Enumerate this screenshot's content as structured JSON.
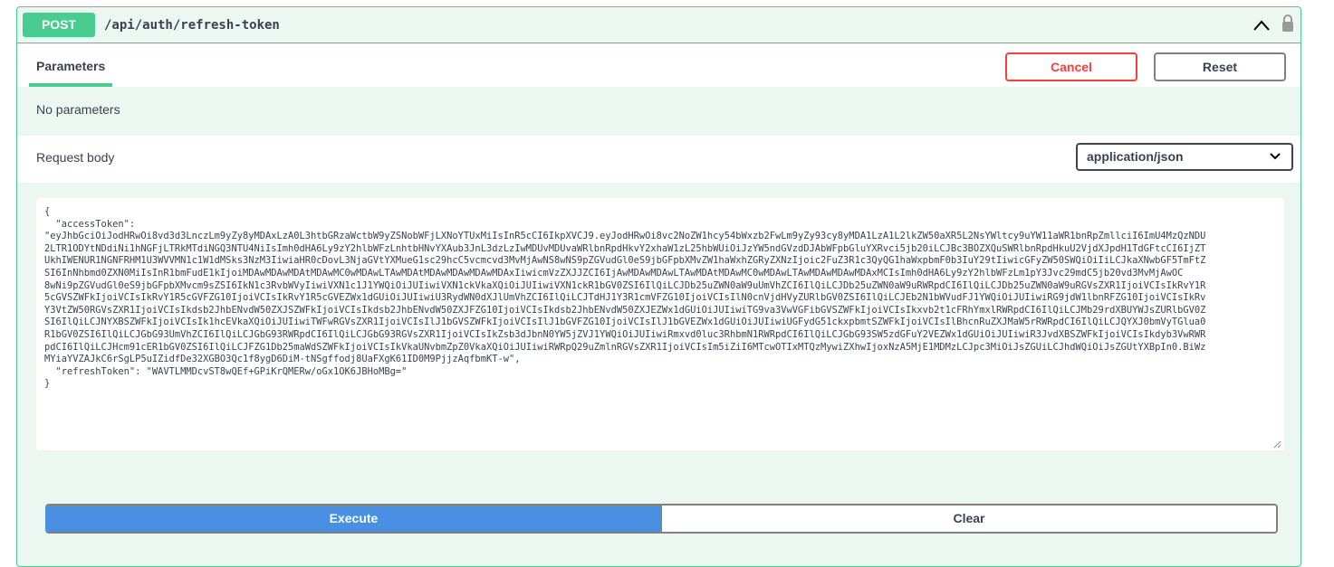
{
  "operation": {
    "method": "POST",
    "path": "/api/auth/refresh-token"
  },
  "parameters": {
    "tab_label": "Parameters",
    "cancel_label": "Cancel",
    "reset_label": "Reset",
    "empty_text": "No parameters"
  },
  "request_body": {
    "label": "Request body",
    "content_type": "application/json",
    "body_lines": [
      "{",
      "  \"accessToken\":",
      "\"eyJhbGciOiJodHRwOi8vd3d3LnczLm9yZy8yMDAxLzA0L3htbGRzaWctbW9yZSNobWFjLXNoYTUxMiIsInR5cCI6IkpXVCJ9.eyJodHRwOi8vc2NoZW1hcy54bWxzb2FwLm9yZy93cy8yMDA1LzA1L2lkZW50aXR5L2NsYWltcy9uYW11aWR1bnRpZmllciI6ImU4MzQzNDU",
      "2LTR1ODYtNDdiNi1hNGFjLTRkMTdiNGQ3NTU4NiIsImh0dHA6Ly9zY2hlbWFzLnhtbHNvYXAub3JnL3dzLzIwMDUvMDUvaWRlbnRpdHkvY2xhaW1zL25hbWUiOiJzYW5ndGVzdDJAbWFpbGluYXRvci5jb20iLCJBc3BOZXQuSWRlbnRpdHkuU2VjdXJpdH1TdGFtcCI6IjZT",
      "UkhIWENUR1NGNFRHM1U3WVVMN1c1W1dMSks3NzM3IiwiaHR0cDovL3NjaGVtYXMueG1sc29hcC5vcmcvd3MvMjAwNS8wNS9pZGVudGl0eS9jbGFpbXMvZW1haWxhZGRyZXNzIjoic2FuZ3R1c3QyQG1haWxpbmF0b3IuY29tIiwicGFyZW50SWQiOiIiLCJkaXNwbGF5TmFtZ",
      "SI6InNhbmd0ZXN0MiIsInR1bmFudE1kIjoiMDAwMDAwMDAtMDAwMC0wMDAwLTAwMDAtMDAwMDAwMDAwMDAxIiwicmVzZXJJZCI6IjAwMDAwMDAwLTAwMDAtMDAwMC0wMDAwLTAwMDAwMDAwMDAxMCIsImh0dHA6Ly9zY2hlbWFzLm1pY3Jvc29mdC5jb20vd3MvMjAwOC",
      "8wNi9pZGVudGl0eS9jbGFpbXMvcm9sZSI6IkN1c3RvbWVyIiwiVXN1c1J1YWQiOiJUIiwiVXN1ckVkaXQiOiJUIiwiVXN1ckR1bGV0ZSI6IlQiLCJDb25uZWN0aW9uUmVhZCI6IlQiLCJDb25uZWN0aW9uRWRpdCI6IlQiLCJDb25uZWN0aW9uRGVsZXR1IjoiVCIsIkRvY1R",
      "5cGVSZWFkIjoiVCIsIkRvY1R5cGVFZG10IjoiVCIsIkRvY1R5cGVEZWx1dGUiOiJUIiwiU3RydWN0dXJlUmVhZCI6IlQiLCJTdHJ1Y3R1cmVFZG10IjoiVCIsIlN0cnVjdHVyZURlbGV0ZSI6IlQiLCJEb2N1bWVudFJ1YWQiOiJUIiwiRG9jdW1lbnRFZG10IjoiVCIsIkRv",
      "Y3VtZW50RGVsZXR1IjoiVCIsIkdsb2JhbENvdW50ZXJSZWFkIjoiVCIsIkdsb2JhbENvdW50ZXJFZG10IjoiVCIsIkdsb2JhbENvdW50ZXJEZWx1dGUiOiJUIiwiTG9va3VwVGFibGVSZWFkIjoiVCIsIkxvb2t1cFRhYmxlRWRpdCI6IlQiLCJMb29rdXBUYWJsZURlbGV0Z",
      "SI6IlQiLCJNYXBSZWFkIjoiVCIsIk1hcEVkaXQiOiJUIiwiTWFwRGVsZXR1IjoiVCIsIlJ1bGVSZWFkIjoiVCIsIlJ1bGVFZG10IjoiVCIsIlJ1bGVEZWx1dGUiOiJUIiwiUGFydG51ckxpbmtSZWFkIjoiVCIsIlBhcnRuZXJMaW5rRWRpdCI6IlQiLCJQYXJ0bmVyTGlua0",
      "R1bGV0ZSI6IlQiLCJGbG93UmVhZCI6IlQiLCJGbG93RWRpdCI6IlQiLCJGbG93RGVsZXR1IjoiVCIsIkZsb3dJbnN0YW5jZVJ1YWQiOiJUIiwiRmxvd0luc3RhbmN1RWRpdCI6IlQiLCJGbG93SW5zdGFuY2VEZWx1dGUiOiJUIiwiR3JvdXBSZWFkIjoiVCIsIkdyb3VwRWR",
      "pdCI6IlQiLCJHcm91cER1bGV0ZSI6IlQiLCJFZG1Db25maWdSZWFkIjoiVCIsIkVkaUNvbmZpZ0VkaXQiOiJUIiwiRWRpQ29uZmlnRGVsZXR1IjoiVCIsIm5iZiI6MTcwOTIxMTQzMywiZXhwIjoxNzA5MjE1MDMzLCJpc3MiOiJsZGUiLCJhdWQiOiJsZGUtYXBpIn0.BiWz",
      "MYiaYVZAJkC6rSgLP5uIZidfDe32XGBO3Qc1f8ygD6DiM-tNSgffodj8UaFXgK61ID0M9PjjzAqfbmKT-w\",",
      "  \"refreshToken\": \"WAVTLMMDcvST8wQEf+GPiKrQMERw/oGx1OK6JBHoMBg=\"",
      "}"
    ]
  },
  "actions": {
    "execute_label": "Execute",
    "clear_label": "Clear"
  },
  "colors": {
    "post_green": "#49cc90",
    "cancel_red": "#f93e3e",
    "execute_blue": "#4990e2"
  }
}
